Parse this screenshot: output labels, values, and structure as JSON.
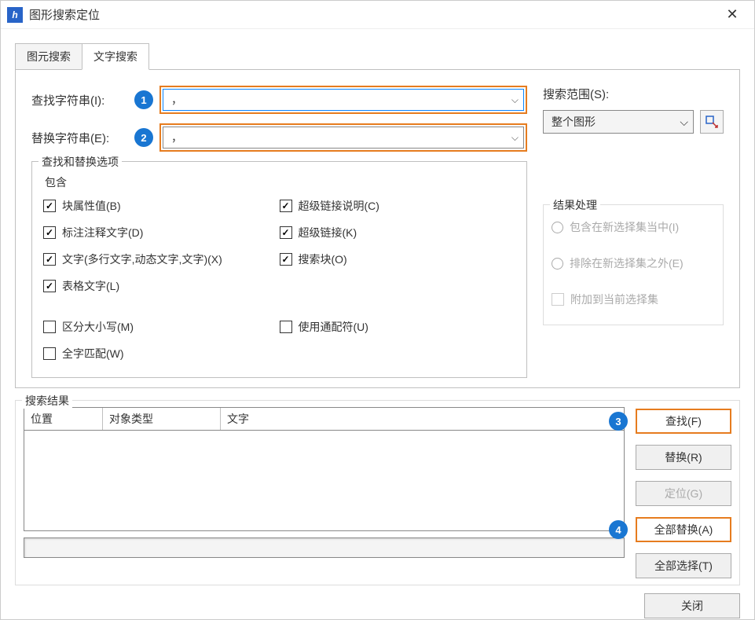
{
  "title": "图形搜索定位",
  "tabs": {
    "element": "图元搜索",
    "text": "文字搜索"
  },
  "form": {
    "find_label": "查找字符串(I):",
    "replace_label": "替换字符串(E):",
    "find_value": "，",
    "replace_value": "，",
    "badge1": "1",
    "badge2": "2"
  },
  "options": {
    "legend": "查找和替换选项",
    "include_label": "包含",
    "items": {
      "block_attr": "块属性值(B)",
      "dim_text": "标注注释文字(D)",
      "text_multi": "文字(多行文字,动态文字,文字)(X)",
      "table_text": "表格文字(L)",
      "hyperlink_desc": "超级链接说明(C)",
      "hyperlink": "超级链接(K)",
      "search_block": "搜索块(O)",
      "case_sensitive": "区分大小写(M)",
      "use_wildcard": "使用通配符(U)",
      "whole_word": "全字匹配(W)"
    }
  },
  "scope": {
    "label": "搜索范围(S):",
    "value": "整个图形"
  },
  "result_opts": {
    "legend": "结果处理",
    "include_sel": "包含在新选择集当中(I)",
    "exclude_sel": "排除在新选择集之外(E)",
    "append_sel": "附加到当前选择集"
  },
  "results": {
    "legend": "搜索结果",
    "headers": {
      "position": "位置",
      "type": "对象类型",
      "text": "文字"
    }
  },
  "buttons": {
    "find": "查找(F)",
    "replace": "替换(R)",
    "locate": "定位(G)",
    "replace_all": "全部替换(A)",
    "select_all": "全部选择(T)",
    "close": "关闭",
    "badge3": "3",
    "badge4": "4"
  }
}
